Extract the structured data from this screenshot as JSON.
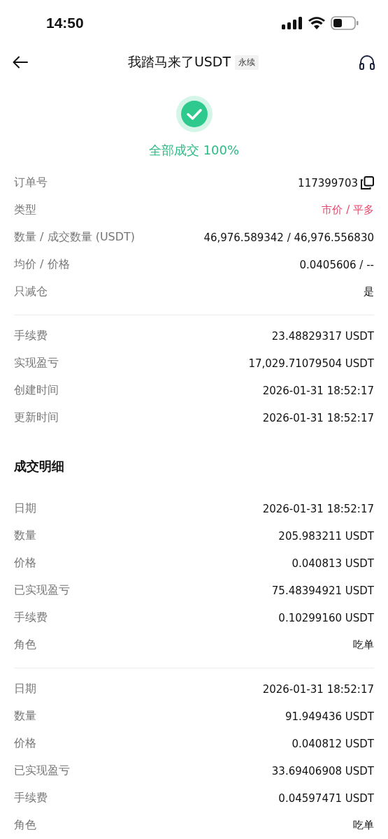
{
  "status_bar": {
    "time": "14:50"
  },
  "header": {
    "title": "我踏马来了USDT",
    "tag": "永续"
  },
  "status": {
    "text": "全部成交 100%"
  },
  "order_rows": [
    {
      "label": "订单号",
      "value": "117399703",
      "kind": "copy"
    },
    {
      "label": "类型",
      "value": "市价 / 平多",
      "kind": "accent"
    },
    {
      "label": "数量 / 成交数量 (USDT)",
      "value": "46,976.589342 / 46,976.556830",
      "kind": "plain"
    },
    {
      "label": "均价 / 价格",
      "value": "0.0405606 / --",
      "kind": "plain"
    },
    {
      "label": "只减仓",
      "value": "是",
      "kind": "plain"
    }
  ],
  "fee_rows": [
    {
      "label": "手续费",
      "value": "23.48829317 USDT"
    },
    {
      "label": "实现盈亏",
      "value": "17,029.71079504 USDT"
    },
    {
      "label": "创建时间",
      "value": "2026-01-31 18:52:17"
    },
    {
      "label": "更新时间",
      "value": "2026-01-31 18:52:17"
    }
  ],
  "trades": {
    "title": "成交明细",
    "fills": [
      [
        {
          "label": "日期",
          "value": "2026-01-31 18:52:17"
        },
        {
          "label": "数量",
          "value": "205.983211 USDT"
        },
        {
          "label": "价格",
          "value": "0.040813 USDT"
        },
        {
          "label": "已实现盈亏",
          "value": "75.48394921 USDT"
        },
        {
          "label": "手续费",
          "value": "0.10299160 USDT"
        },
        {
          "label": "角色",
          "value": "吃单"
        }
      ],
      [
        {
          "label": "日期",
          "value": "2026-01-31 18:52:17"
        },
        {
          "label": "数量",
          "value": "91.949436 USDT"
        },
        {
          "label": "价格",
          "value": "0.040812 USDT"
        },
        {
          "label": "已实现盈亏",
          "value": "33.69406908 USDT"
        },
        {
          "label": "手续费",
          "value": "0.04597471 USDT"
        },
        {
          "label": "角色",
          "value": "吃单"
        }
      ]
    ]
  }
}
